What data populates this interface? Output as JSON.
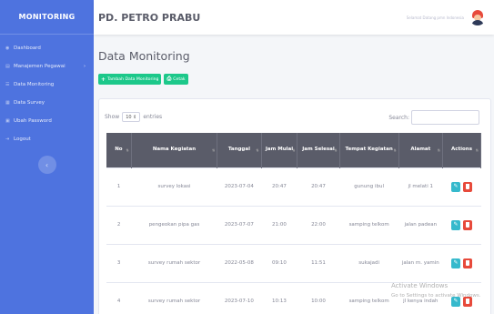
{
  "sidebar": {
    "brand": "MONITORING",
    "items": [
      {
        "label": "Dashboard",
        "icon": "dashboard-icon"
      },
      {
        "label": "Manajemen Pegawai",
        "icon": "users-icon",
        "chevron": "›"
      },
      {
        "label": "Data Monitoring",
        "icon": "list-icon"
      },
      {
        "label": "Data Survey",
        "icon": "survey-icon"
      },
      {
        "label": "Ubah Password",
        "icon": "lock-icon"
      },
      {
        "label": "Logout",
        "icon": "logout-icon"
      }
    ],
    "toggle_icon": "‹",
    "color": "#4e73df"
  },
  "topbar": {
    "title": "PD. PETRO PRABU",
    "welcome": "Selamat Datang pmn Indonesia"
  },
  "main": {
    "title": "Data Monitoring",
    "btn_add": "Tambah Data Monitoring",
    "btn_print": "Cetak",
    "show_label": "Show",
    "show_value": "10",
    "entries_label": "entries",
    "search_label": "Search:"
  },
  "table": {
    "headers": [
      "No",
      "Nama Kegiatan",
      "Tanggal",
      "Jam Mulai",
      "Jam Selesai",
      "Tempat Kegiatan",
      "Alamat",
      "Actions"
    ],
    "rows": [
      [
        "1",
        "survey lokasi",
        "2023-07-04",
        "20:47",
        "20:47",
        "gunung ibul",
        "jl melati 1"
      ],
      [
        "2",
        "pengeokan pipa gas",
        "2023-07-07",
        "21:00",
        "22:00",
        "samping telkom",
        "jalan padean"
      ],
      [
        "3",
        "survey rumah sektor",
        "2022-05-08",
        "09:10",
        "11:51",
        "sukajadi",
        "jalan m. yamin"
      ],
      [
        "4",
        "survey rumah sektor",
        "2023-07-10",
        "10:13",
        "10:00",
        "samping telkom",
        "jl kenya indah"
      ]
    ]
  },
  "watermark": {
    "line1": "Activate Windows",
    "line2": "Go to Settings to activate Windows."
  },
  "colors": {
    "primary": "#4e73df",
    "success": "#1cc88a",
    "info": "#36b9cc",
    "danger": "#e74a3b",
    "header_dark": "#5a5c69"
  }
}
